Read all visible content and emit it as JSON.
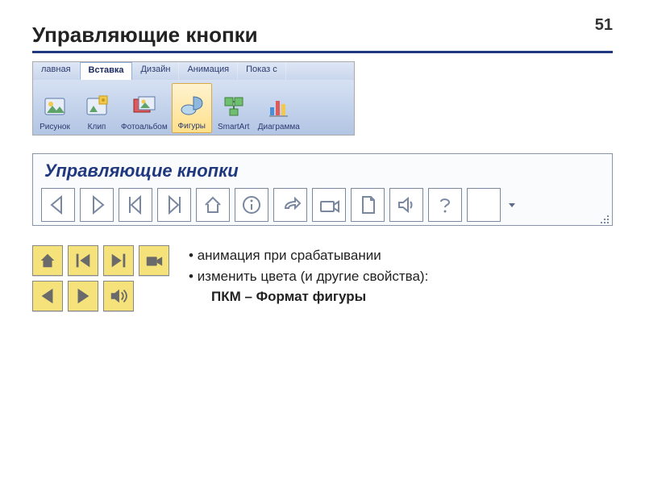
{
  "page_number": "51",
  "heading": "Управляющие кнопки",
  "ribbon": {
    "tabs": [
      "лавная",
      "Вставка",
      "Дизайн",
      "Анимация",
      "Показ с"
    ],
    "active_tab_index": 1,
    "buttons": [
      {
        "label": "Рисунок",
        "icon": "picture"
      },
      {
        "label": "Клип",
        "icon": "clip"
      },
      {
        "label": "Фотоальбом",
        "icon": "album"
      },
      {
        "label": "Фигуры",
        "icon": "shapes",
        "selected": true
      },
      {
        "label": "SmartArt",
        "icon": "smartart"
      },
      {
        "label": "Диаграмма",
        "icon": "chart"
      }
    ]
  },
  "panel": {
    "title": "Управляющие кнопки",
    "buttons": [
      "back",
      "forward",
      "first",
      "last",
      "home",
      "info",
      "return",
      "movie",
      "document",
      "sound",
      "help",
      "blank"
    ]
  },
  "samples": {
    "row1": [
      "home",
      "first",
      "last",
      "movie"
    ],
    "row2": [
      "back",
      "forward",
      "sound"
    ]
  },
  "notes": {
    "bullet1": "анимация при срабатывании",
    "bullet2_prefix": "изменить цвета (и другие свойства):",
    "line3_strong": "ПКМ",
    "line3_rest": " – Формат фигуры"
  }
}
